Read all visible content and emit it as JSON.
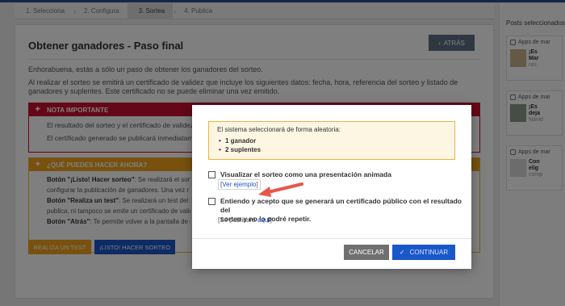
{
  "steps": [
    {
      "label": "1. Selecciona",
      "active": false
    },
    {
      "label": "2. Configura",
      "active": false
    },
    {
      "label": "3. Sortea",
      "active": true
    },
    {
      "label": "4. Publica",
      "active": false
    }
  ],
  "page": {
    "title": "Obtener ganadores - Paso final",
    "back_label": "ATRÁS",
    "intro1": "Enhorabuena, estás a sólo un paso de obtener los ganadores del sorteo.",
    "intro2": "Al realizar el sorteo se emitirá un certificado de validez que incluye los siguientes datos: fecha, hora, referencia del sorteo y listado de ganadores y suplentes. Este certificado no se puede eliminar una vez emitido.",
    "note": {
      "title": "NOTA IMPORTANTE",
      "line1": "El resultado del sorteo y el certificado de validez an",
      "line2": "El certificado generado se publicará inmediatamen"
    },
    "what": {
      "title": "¿QUÉ PUEDES HACER AHORA?",
      "l1_b": "Botón \"¡Listo! Hacer sorteo\"",
      "l1": ": Se realizará el sorte",
      "l2": "configurar la publicación de ganadores. Una vez r",
      "l3_b": "Botón \"Realiza un test\"",
      "l3": ": Se realizará un test del so",
      "l4": "publica, ni tampoco se emite un certificado de valide",
      "l5_b": "Botón \"Atrás\"",
      "l5": ": Te permite volver a la pantalla de co"
    },
    "test_label": "REALIZA UN TEST",
    "go_label": "¡LISTO! HACER SORTEO"
  },
  "sidebar": {
    "title": "Posts seleccionados",
    "posts": [
      {
        "source": "Apps de mar",
        "line1": "¡Es",
        "line2": "Mar",
        "line3": "res"
      },
      {
        "source": "Apps de mar",
        "line1": "¡Es",
        "line2": "deja",
        "line3": "Navid"
      },
      {
        "source": "Apps de mar",
        "line1": "Con",
        "line2": "elig",
        "line3": "comp"
      }
    ]
  },
  "modal": {
    "info_lead": "El sistema seleccionará de forma aleatoria:",
    "info_items": [
      "1 ganador",
      "2 suplentes"
    ],
    "option1_label": "Visualizar el sorteo como una presentación animada",
    "option1_link": "Ver ejemplo",
    "option2_label_l1": "Entiendo y acepto que se generará un certificado público con el resultado del",
    "option2_label_l2": "sorteo y no lo podré repetir.",
    "publish_prefix": "Se publicará",
    "publish_link": "aquí",
    "cancel_label": "CANCELAR",
    "continue_label": "CONTINUAR"
  },
  "colors": {
    "brand_blue": "#1a57c9",
    "warning_red": "#c8102e",
    "warning_orange": "#f0a31c",
    "arrow_red": "#e8574a"
  }
}
